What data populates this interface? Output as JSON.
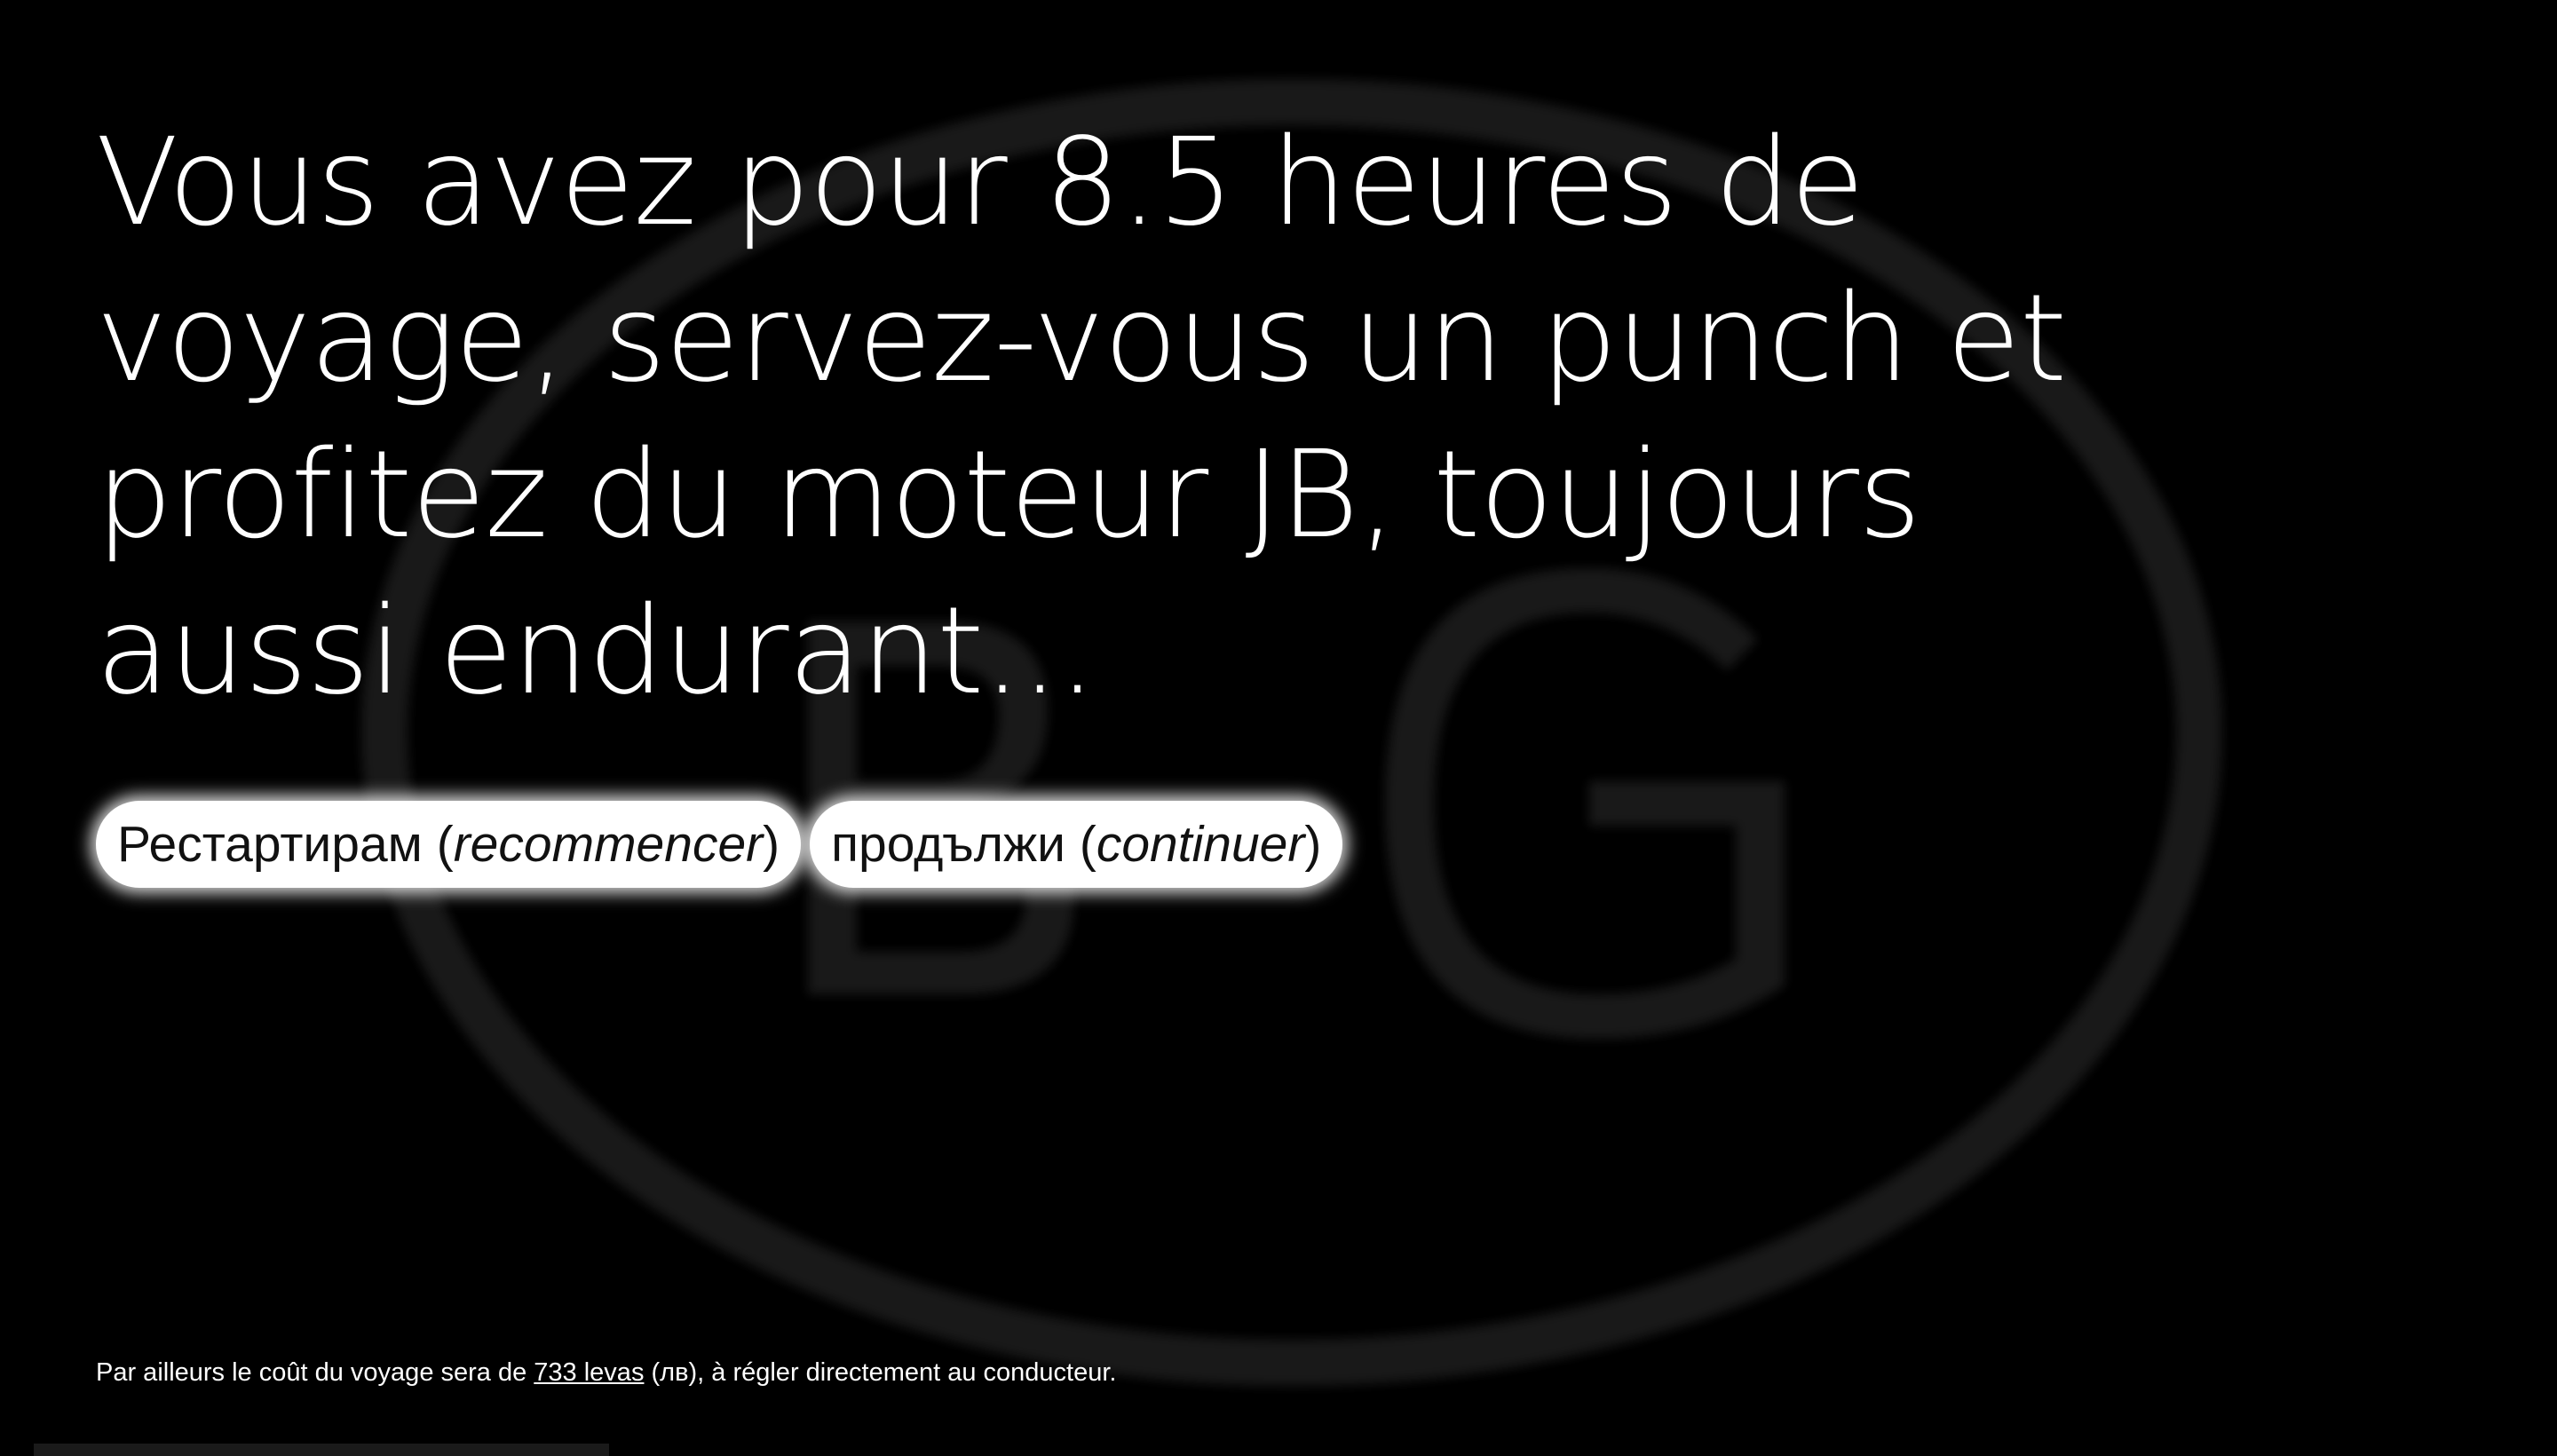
{
  "headline": "Vous avez pour 8.5 heures de voyage, servez-vous un punch et profitez du moteur JB, toujours aussi endurant...",
  "actions": {
    "restart": {
      "label": "Рестартирам",
      "translation": "recommencer"
    },
    "continue": {
      "label": "продължи",
      "translation": "continuer"
    }
  },
  "footer": {
    "prefix": "Par ailleurs le coût du voyage sera de ",
    "price_link": "733 levas",
    "suffix": " (лв), à régler directement au conducteur."
  },
  "background": {
    "logo_icon": "bg-oval-logo-icon",
    "logo_color": "#1c1c1c"
  }
}
